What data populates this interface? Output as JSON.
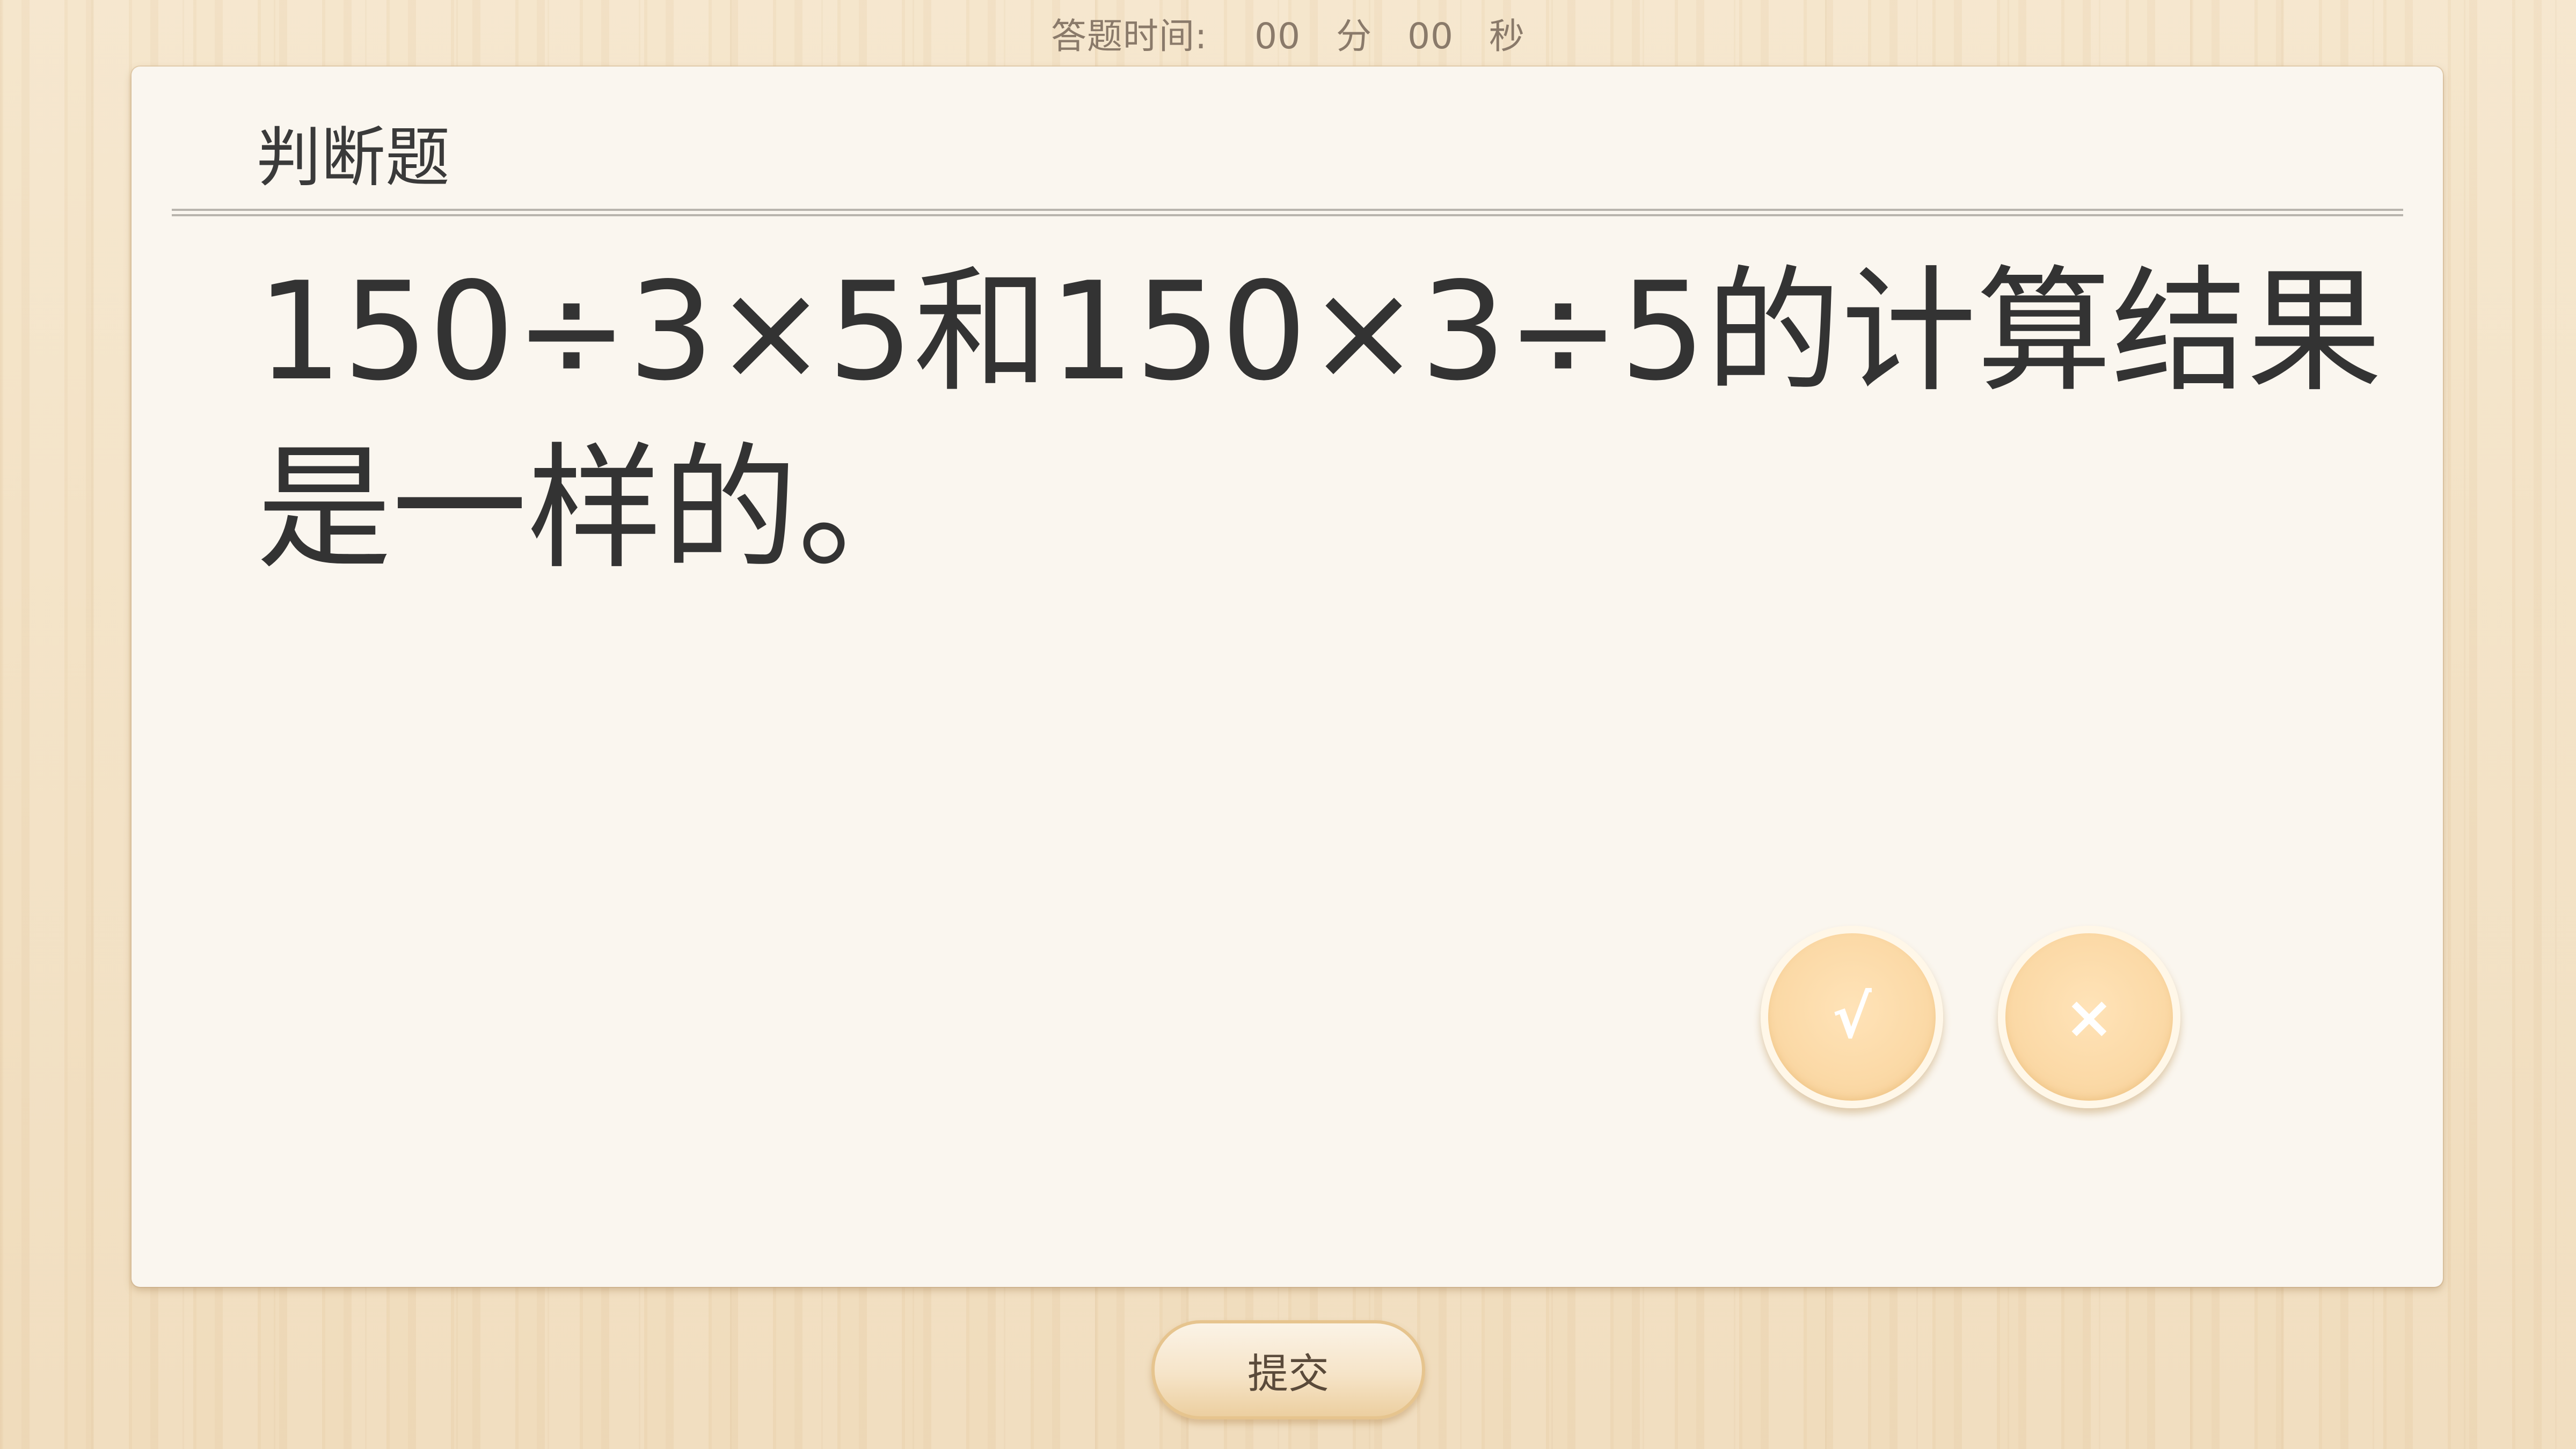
{
  "timer": {
    "label": "答题时间:",
    "minutes": "00",
    "minutes_unit": "分",
    "seconds": "00",
    "seconds_unit": "秒"
  },
  "question": {
    "type": "判断题",
    "text": "150÷3×5和150×3÷5的计算结果是一样的。"
  },
  "answers": {
    "true_label": "√",
    "false_label": "×"
  },
  "submit_label": "提交",
  "colors": {
    "card_background": "#faf6ef",
    "answer_button": "#fbd9a6",
    "page_background": "#f3e2c6"
  }
}
